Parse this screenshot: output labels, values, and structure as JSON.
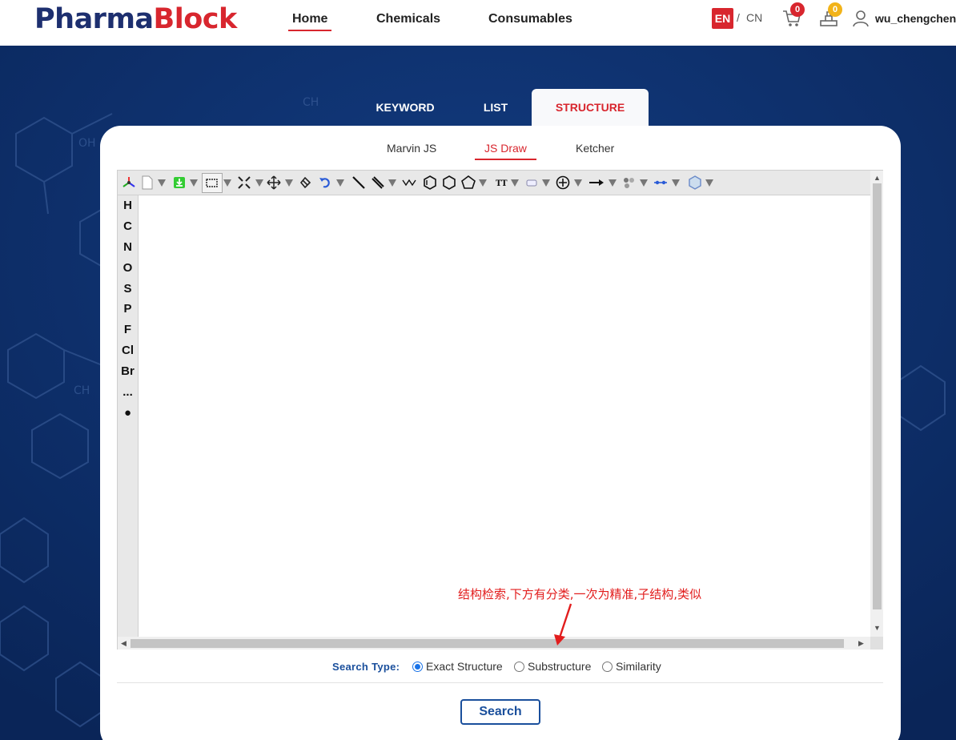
{
  "header": {
    "logo_part1": "Pharma",
    "logo_part2": "Block",
    "nav": {
      "home": "Home",
      "chemicals": "Chemicals",
      "consumables": "Consumables"
    },
    "lang": {
      "en": "EN",
      "separator": "/",
      "cn": "CN"
    },
    "cart_count": "0",
    "quote_count": "0",
    "username": "wu_chengchen"
  },
  "search_tabs": {
    "keyword": "KEYWORD",
    "list": "LIST",
    "structure": "STRUCTURE",
    "active": "STRUCTURE"
  },
  "editor_tabs": {
    "marvin": "Marvin JS",
    "jsdraw": "JS Draw",
    "ketcher": "Ketcher",
    "active": "JS Draw"
  },
  "atoms": [
    "H",
    "C",
    "N",
    "O",
    "S",
    "P",
    "F",
    "Cl",
    "Br",
    "...",
    "●"
  ],
  "toolbar_icons": [
    "template-icon",
    "new-document-icon",
    "download-icon",
    "select-rectangle-icon",
    "lasso-select-icon",
    "move-icon",
    "eraser-icon",
    "undo-icon",
    "single-bond-icon",
    "double-bond-icon",
    "chain-icon",
    "benzene-ring-icon",
    "hexagon-ring-icon",
    "pentagon-ring-icon",
    "text-icon",
    "rectangle-shape-icon",
    "charge-plus-icon",
    "reaction-arrow-icon",
    "group-icon",
    "bracket-icon",
    "query-icon"
  ],
  "annotation": "结构检索,下方有分类,一次为精准,子结构,类似",
  "search_type": {
    "label": "Search Type:",
    "options": [
      "Exact Structure",
      "Substructure",
      "Similarity"
    ],
    "selected": "Exact Structure"
  },
  "search_button": "Search",
  "colors": {
    "brand_blue": "#1d2f6f",
    "brand_red": "#d8262e",
    "background": "#0d2d66",
    "link_blue": "#1a4f9c"
  }
}
